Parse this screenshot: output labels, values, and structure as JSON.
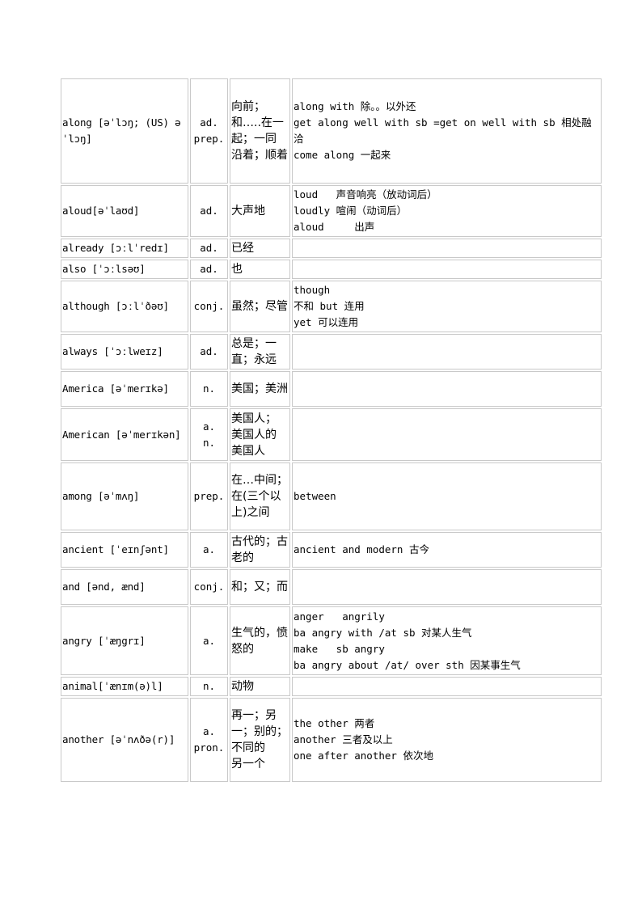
{
  "table": {
    "rows": [
      {
        "word": "along [əˈlɔŋ; (US) əˈlɔŋ]",
        "pos": [
          "ad.",
          "prep."
        ],
        "meaning": [
          "向前；",
          "和…..在一起；一同",
          "沿着；顺着"
        ],
        "notes": [
          "along with 除。。以外还",
          "get along well with sb =get on well with sb 相处融洽",
          "come along 一起来"
        ],
        "height": 130
      },
      {
        "word": "aloud[əˈlaʊd]",
        "pos": [
          "ad."
        ],
        "meaning": [
          "大声地"
        ],
        "notes": [
          "loud   声音响亮（放动词后）",
          "loudly 喧闹（动词后）",
          "aloud     出声"
        ],
        "height": 64
      },
      {
        "word": "already [ɔːlˈredɪ]",
        "pos": [
          "ad."
        ],
        "meaning": [
          "已经"
        ],
        "notes": [],
        "height": 22
      },
      {
        "word": "also [ˈɔːlsəʊ]",
        "pos": [
          "ad."
        ],
        "meaning": [
          "也"
        ],
        "notes": [],
        "height": 22
      },
      {
        "word": "although [ɔːlˈðəʊ]",
        "pos": [
          "conj."
        ],
        "meaning": [
          "虽然；尽管"
        ],
        "notes": [
          "though",
          "不和 but 连用",
          "yet 可以连用"
        ],
        "height": 64
      },
      {
        "word": "always [ˈɔːlweɪz]",
        "pos": [
          "ad."
        ],
        "meaning": [
          "总是；一直；永远"
        ],
        "notes": [],
        "height": 44
      },
      {
        "word": "America [əˈmerɪkə]",
        "pos": [
          "n."
        ],
        "meaning": [
          "美国；美洲"
        ],
        "notes": [],
        "height": 44
      },
      {
        "word": "American [əˈmerɪkən]",
        "pos": [
          "a.",
          "n."
        ],
        "meaning": [
          "美国人；",
          "美国人的",
          "美国人"
        ],
        "notes": [],
        "height": 65
      },
      {
        "word": "among [əˈmʌŋ]",
        "pos": [
          "prep."
        ],
        "meaning": [
          "在…中间；在(三个以上)之间"
        ],
        "notes": [
          "between"
        ],
        "height": 84
      },
      {
        "word": "ancient  [ˈeɪnʃənt]",
        "pos": [
          "a."
        ],
        "meaning": [
          "古代的；古老的"
        ],
        "notes": [
          "ancient and modern 古今"
        ],
        "height": 44
      },
      {
        "word": "and [ənd, ænd]",
        "pos": [
          "conj."
        ],
        "meaning": [
          "和；又；而"
        ],
        "notes": [],
        "height": 44
      },
      {
        "word": "angry [ˈæŋgrɪ]",
        "pos": [
          "a."
        ],
        "meaning": [
          "生气的，愤怒的"
        ],
        "notes": [
          "anger   angrily",
          "ba angry with /at sb 对某人生气",
          "make   sb angry",
          "ba angry about /at/ over sth 因某事生气"
        ],
        "height": 85
      },
      {
        "word": "animal[ˈænɪm(ə)l]",
        "pos": [
          "n."
        ],
        "meaning": [
          "动物"
        ],
        "notes": [],
        "height": 22
      },
      {
        "word": "another [əˈnʌðə(r)]",
        "pos": [
          "a.",
          "pron."
        ],
        "meaning": [
          "再一；另一；别的；不同的",
          "另一个"
        ],
        "notes": [
          "the other 两者",
          "another 三者及以上",
          "one after another 依次地"
        ],
        "height": 104
      }
    ]
  }
}
